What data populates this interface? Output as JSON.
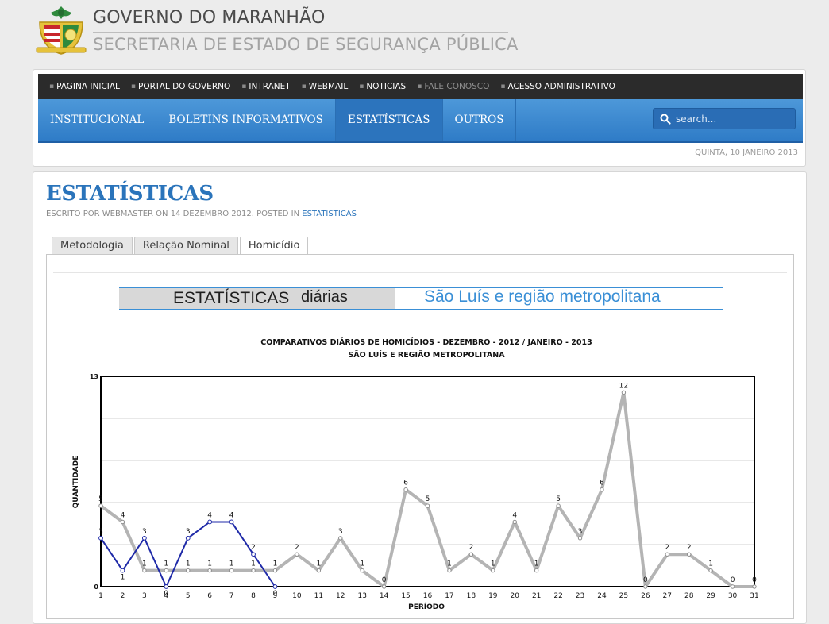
{
  "header": {
    "title": "GOVERNO DO MARANHÃO",
    "subtitle": "SECRETARIA DE ESTADO DE SEGURANÇA PÚBLICA"
  },
  "top_links": [
    {
      "label": "PAGINA INICIAL"
    },
    {
      "label": "PORTAL DO GOVERNO"
    },
    {
      "label": "INTRANET"
    },
    {
      "label": "WEBMAIL"
    },
    {
      "label": "NOTICIAS"
    },
    {
      "label": "FALE CONOSCO"
    },
    {
      "label": "ACESSO ADMINISTRATIVO"
    }
  ],
  "main_nav": [
    {
      "label": "INSTITUCIONAL"
    },
    {
      "label": "BOLETINS INFORMATIVOS"
    },
    {
      "label": "ESTATÍSTICAS"
    },
    {
      "label": "OUTROS"
    }
  ],
  "search": {
    "placeholder": "search..."
  },
  "date": "QUINTA, 10 JANEIRO 2013",
  "article": {
    "title": "ESTATÍSTICAS",
    "byline_prefix": "ESCRITO POR WEBMASTER ON 14 DEZEMBRO 2012. POSTED IN",
    "byline_category": "ESTATISTICAS"
  },
  "tabs": [
    {
      "label": "Metodologia"
    },
    {
      "label": "Relação Nominal"
    },
    {
      "label": "Homicídio"
    }
  ],
  "banner": {
    "left": "ESTATÍSTICAS",
    "middle": "diárias",
    "right": "São Luís e região metropolitana",
    "accent_color": "#3a8fd6"
  },
  "chart_data": {
    "type": "line",
    "title": "COMPARATIVOS DIÁRIOS DE HOMICÍDIOS - DEZEMBRO - 2012 / JANEIRO - 2013",
    "subtitle": "SÃO LUÍS E REGIÃO METROPOLITANA",
    "xlabel": "PERÍODO",
    "ylabel": "QUANTIDADE",
    "x": [
      1,
      2,
      3,
      4,
      5,
      6,
      7,
      8,
      9,
      10,
      11,
      12,
      13,
      14,
      15,
      16,
      17,
      18,
      19,
      20,
      21,
      22,
      23,
      24,
      25,
      26,
      27,
      28,
      29,
      30,
      31
    ],
    "ylim": [
      0,
      13
    ],
    "yticks": [
      0,
      13
    ],
    "grid": true,
    "series": [
      {
        "color": "#b4b4b4",
        "values": [
          5,
          4,
          1,
          1,
          1,
          1,
          1,
          1,
          1,
          2,
          1,
          3,
          1,
          0,
          6,
          5,
          1,
          2,
          1,
          4,
          1,
          5,
          3,
          6,
          12,
          0,
          2,
          2,
          1,
          0,
          0
        ]
      },
      {
        "color": "#1f2aa8",
        "values": [
          3,
          1,
          3,
          0,
          3,
          4,
          4,
          2,
          0
        ]
      }
    ]
  }
}
